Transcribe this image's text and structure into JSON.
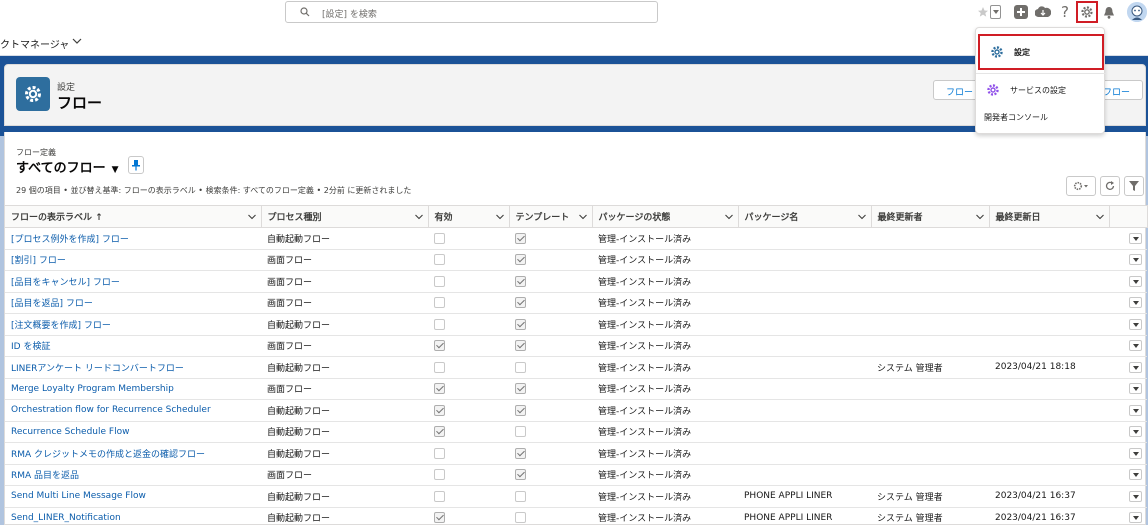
{
  "search": {
    "placeholder": "[設定] を検索"
  },
  "nav": {
    "app_name": "クトマネージャ"
  },
  "header": {
    "subtitle": "設定",
    "title": "フロー",
    "btn_new_left": "フロー",
    "btn_new_right": "フロー"
  },
  "list": {
    "subtitle": "フロー定義",
    "title": "すべてのフロー",
    "meta": "29 個の項目 • 並び替え基準: フローの表示ラベル • 検索条件: すべてのフロー定義 • 2分前 に更新されました",
    "columns": [
      "フローの表示ラベル ↑",
      "プロセス種別",
      "有効",
      "テンプレート",
      "パッケージの状態",
      "パッケージ名",
      "最終更新者",
      "最終更新日"
    ],
    "rows": [
      {
        "label": "[プロセス例外を作成] フロー",
        "type": "自動起動フロー",
        "active": false,
        "template": true,
        "status": "管理-インストール済み",
        "pkg": "",
        "by": "",
        "date": ""
      },
      {
        "label": "[割引] フロー",
        "type": "画面フロー",
        "active": false,
        "template": true,
        "status": "管理-インストール済み",
        "pkg": "",
        "by": "",
        "date": ""
      },
      {
        "label": "[品目をキャンセル] フロー",
        "type": "画面フロー",
        "active": false,
        "template": true,
        "status": "管理-インストール済み",
        "pkg": "",
        "by": "",
        "date": ""
      },
      {
        "label": "[品目を返品] フロー",
        "type": "画面フロー",
        "active": false,
        "template": true,
        "status": "管理-インストール済み",
        "pkg": "",
        "by": "",
        "date": ""
      },
      {
        "label": "[注文概要を作成] フロー",
        "type": "自動起動フロー",
        "active": false,
        "template": true,
        "status": "管理-インストール済み",
        "pkg": "",
        "by": "",
        "date": ""
      },
      {
        "label": "ID を検証",
        "type": "画面フロー",
        "active": true,
        "template": true,
        "status": "管理-インストール済み",
        "pkg": "",
        "by": "",
        "date": ""
      },
      {
        "label": "LINERアンケート リードコンバートフロー",
        "type": "自動起動フロー",
        "active": false,
        "template": false,
        "status": "管理-インストール済み",
        "pkg": "",
        "by": "システム 管理者",
        "date": "2023/04/21 18:18"
      },
      {
        "label": "Merge Loyalty Program Membership",
        "type": "画面フロー",
        "active": true,
        "template": true,
        "status": "管理-インストール済み",
        "pkg": "",
        "by": "",
        "date": ""
      },
      {
        "label": "Orchestration flow for Recurrence Scheduler",
        "type": "自動起動フロー",
        "active": true,
        "template": true,
        "status": "管理-インストール済み",
        "pkg": "",
        "by": "",
        "date": ""
      },
      {
        "label": "Recurrence Schedule Flow",
        "type": "自動起動フロー",
        "active": true,
        "template": false,
        "status": "管理-インストール済み",
        "pkg": "",
        "by": "",
        "date": ""
      },
      {
        "label": "RMA クレジットメモの作成と返金の確認フロー",
        "type": "自動起動フロー",
        "active": false,
        "template": true,
        "status": "管理-インストール済み",
        "pkg": "",
        "by": "",
        "date": ""
      },
      {
        "label": "RMA 品目を返品",
        "type": "画面フロー",
        "active": false,
        "template": true,
        "status": "管理-インストール済み",
        "pkg": "",
        "by": "",
        "date": ""
      },
      {
        "label": "Send Multi Line Message Flow",
        "type": "自動起動フロー",
        "active": false,
        "template": false,
        "status": "管理-インストール済み",
        "pkg": "PHONE APPLI LINER",
        "by": "システム 管理者",
        "date": "2023/04/21 16:37"
      },
      {
        "label": "Send_LINER_Notification",
        "type": "自動起動フロー",
        "active": true,
        "template": false,
        "status": "管理-インストール済み",
        "pkg": "PHONE APPLI LINER",
        "by": "システム 管理者",
        "date": "2023/04/21 16:37"
      }
    ]
  },
  "menu": {
    "setup": "設定",
    "service_setup": "サービスの設定",
    "dev_console": "開発者コンソール"
  },
  "colors": {
    "accent": "#0176d3",
    "brand_dark": "#1b5297",
    "highlight": "#d01d25",
    "service_icon": "#9050e9"
  }
}
